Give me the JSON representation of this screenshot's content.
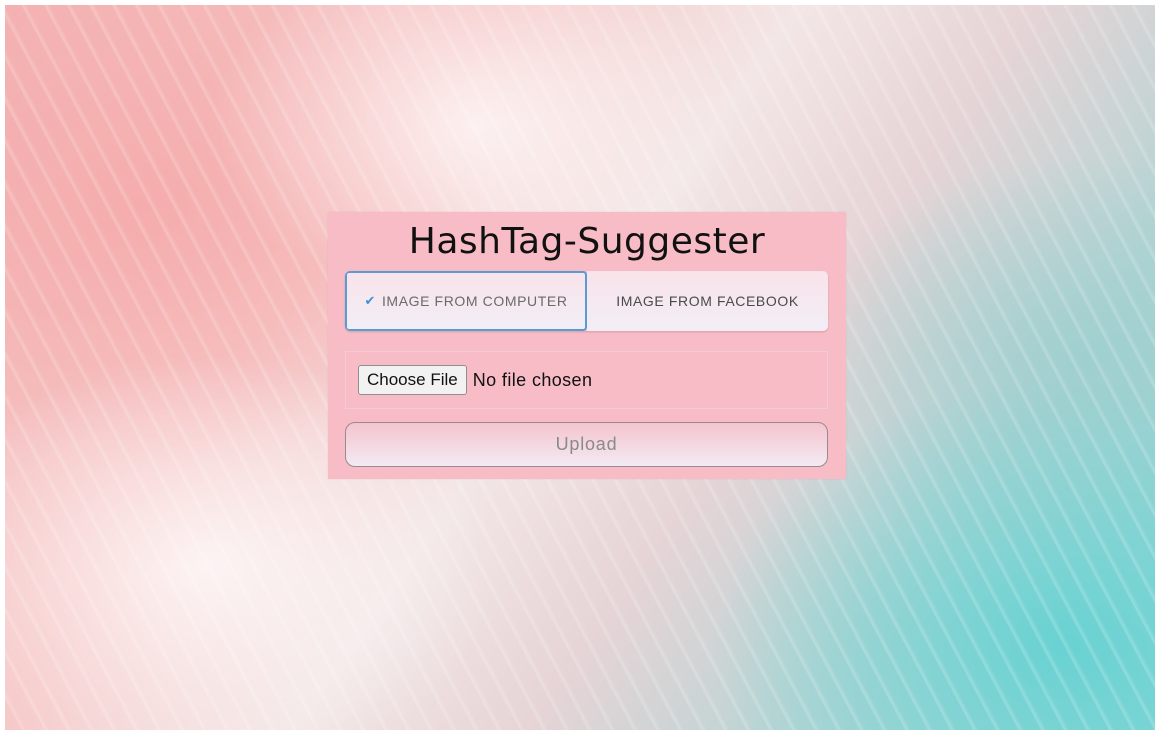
{
  "app": {
    "title": "HashTag-Suggester"
  },
  "tabs": [
    {
      "label": "IMAGE FROM COMPUTER",
      "selected": true,
      "icon": "check-icon"
    },
    {
      "label": "IMAGE FROM FACEBOOK",
      "selected": false
    }
  ],
  "file_input": {
    "button_label": "Choose File",
    "status": "No file chosen"
  },
  "upload": {
    "label": "Upload"
  },
  "colors": {
    "panel": "#f8bcc6",
    "active_tab_border": "#5a9bd5",
    "check": "#3d8fd6"
  }
}
